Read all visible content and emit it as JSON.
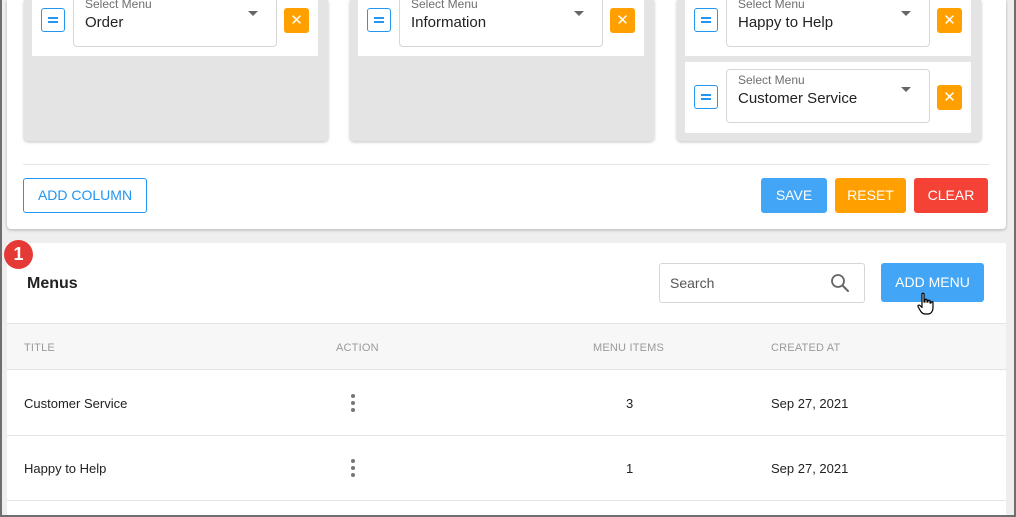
{
  "builder": {
    "columns": [
      {
        "slots": [
          {
            "caption": "Select Menu",
            "value": "Order"
          }
        ]
      },
      {
        "slots": [
          {
            "caption": "Select Menu",
            "value": "Information"
          }
        ]
      },
      {
        "slots": [
          {
            "caption": "Select Menu",
            "value": "Happy to Help"
          },
          {
            "caption": "Select Menu",
            "value": "Customer Service"
          }
        ]
      }
    ],
    "remove_glyph": "✕",
    "add_column_label": "ADD COLUMN",
    "save_label": "SAVE",
    "reset_label": "RESET",
    "clear_label": "CLEAR"
  },
  "menus": {
    "step_badge": "1",
    "title": "Menus",
    "search_placeholder": "Search",
    "add_menu_label": "ADD MENU",
    "columns": [
      "TITLE",
      "ACTION",
      "MENU ITEMS",
      "CREATED AT"
    ],
    "rows": [
      {
        "title": "Customer Service",
        "items": "3",
        "created": "Sep 27, 2021"
      },
      {
        "title": "Happy to Help",
        "items": "1",
        "created": "Sep 27, 2021"
      }
    ]
  },
  "colors": {
    "primary": "#42a5f5",
    "warning": "#ffa000",
    "danger": "#f44336",
    "badge": "#e53935"
  },
  "icons": {
    "drag": "drag-handle-icon",
    "remove": "close-icon",
    "dropdown": "caret-down-icon",
    "search": "search-icon",
    "action": "more-vertical-icon",
    "pointer": "hand-pointer-icon"
  }
}
